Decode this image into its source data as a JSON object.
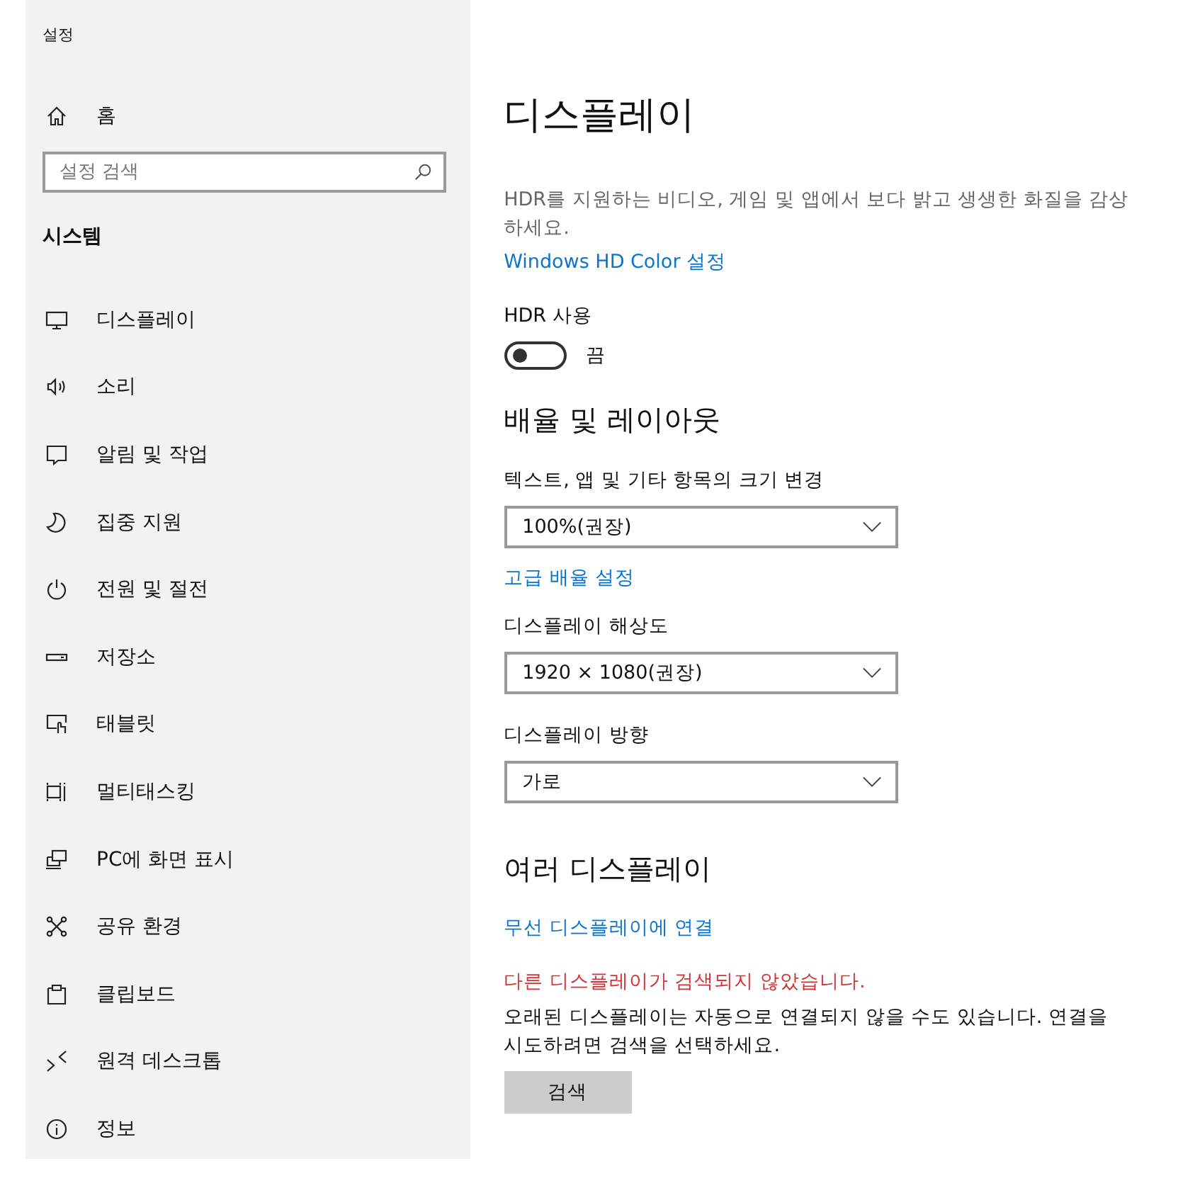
{
  "window": {
    "title": "설정"
  },
  "sidebar": {
    "home": "홈",
    "search": {
      "placeholder": "설정 검색"
    },
    "section": "시스템",
    "items": [
      {
        "label": "디스플레이"
      },
      {
        "label": "소리"
      },
      {
        "label": "알림 및 작업"
      },
      {
        "label": "집중 지원"
      },
      {
        "label": "전원 및 절전"
      },
      {
        "label": "저장소"
      },
      {
        "label": "태블릿"
      },
      {
        "label": "멀티태스킹"
      },
      {
        "label": "PC에 화면 표시"
      },
      {
        "label": "공유 환경"
      },
      {
        "label": "클립보드"
      },
      {
        "label": "원격 데스크톱"
      },
      {
        "label": "정보"
      }
    ]
  },
  "page": {
    "title": "디스플레이",
    "hdr": {
      "description": "HDR를 지원하는 비디오, 게임 및 앱에서 보다 밝고 생생한 화질을 감상하세요.",
      "link": "Windows HD Color 설정",
      "toggle": {
        "label": "HDR 사용",
        "on": false,
        "state_text": "끔"
      }
    },
    "scale": {
      "heading": "배율 및 레이아웃",
      "fields": [
        {
          "label": "텍스트, 앱 및 기타 항목의 크기 변경",
          "value": "100%(권장)",
          "link": "고급 배율 설정"
        },
        {
          "label": "디스플레이 해상도",
          "value": "1920 × 1080(권장)"
        },
        {
          "label": "디스플레이 방향",
          "value": "가로"
        }
      ]
    },
    "multi": {
      "heading": "여러 디스플레이",
      "link": "무선 디스플레이에 연결",
      "error": "다른 디스플레이가 검색되지 않았습니다.",
      "note": "오래된 디스플레이는 자동으로 연결되지 않을 수도 있습니다. 연결을 시도하려면 검색을 선택하세요.",
      "button": "검색"
    }
  }
}
